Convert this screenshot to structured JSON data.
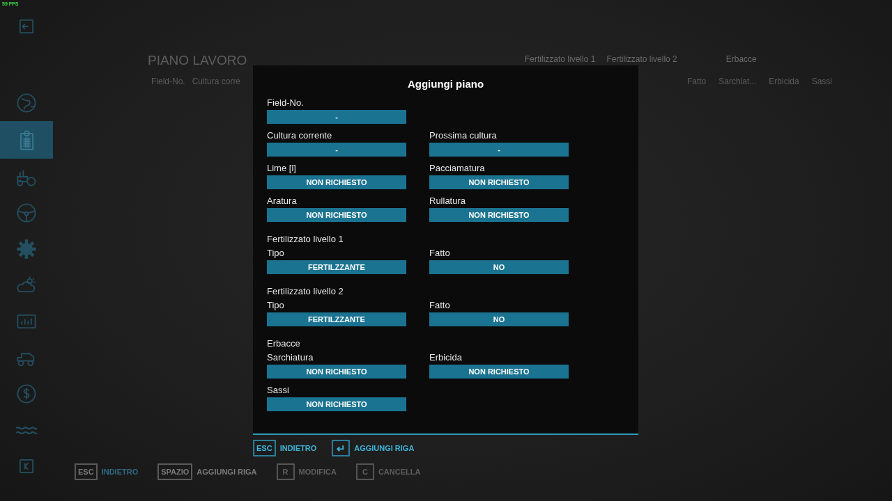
{
  "fps": "59 FPS",
  "sidebar": {
    "items": [
      {
        "kind": "back",
        "selected": false
      },
      {
        "kind": "globe",
        "selected": false
      },
      {
        "kind": "clipboard",
        "selected": true
      },
      {
        "kind": "tractor",
        "selected": false
      },
      {
        "kind": "wheel",
        "selected": false
      },
      {
        "kind": "gear",
        "selected": false
      },
      {
        "kind": "weather",
        "selected": false
      },
      {
        "kind": "chart",
        "selected": false
      },
      {
        "kind": "vehicle",
        "selected": false
      },
      {
        "kind": "coin",
        "selected": false
      },
      {
        "kind": "wave",
        "selected": false
      },
      {
        "kind": "key",
        "selected": false
      }
    ]
  },
  "page": {
    "title": "PIANO LAVORO",
    "group_headers": [
      "Fertilizzato livello 1",
      "Fertilizzato livello 2",
      "Erbacce"
    ],
    "columns_left": [
      "Field-No.",
      "Cultura corre"
    ],
    "columns_right": [
      "Fatto",
      "Sarchiat...",
      "Erbicida",
      "Sassi"
    ],
    "key_hints": [
      {
        "key": "ESC",
        "label": "INDIETRO",
        "disabled": false
      },
      {
        "key": "SPAZIO",
        "label": "AGGIUNGI RIGA",
        "disabled": false
      },
      {
        "key": "R",
        "label": "MODIFICA",
        "disabled": true
      },
      {
        "key": "C",
        "label": "CANCELLA",
        "disabled": true
      }
    ]
  },
  "dialog": {
    "title": "Aggiungi piano",
    "rows": [
      {
        "fields": [
          {
            "label": "Field-No.",
            "value": "-"
          }
        ]
      },
      {
        "fields": [
          {
            "label": "Cultura corrente",
            "value": "-"
          },
          {
            "label": "Prossima cultura",
            "value": "-"
          }
        ]
      },
      {
        "fields": [
          {
            "label": "Lime [l]",
            "value": "NON RICHIESTO"
          },
          {
            "label": "Pacciamatura",
            "value": "NON RICHIESTO"
          }
        ]
      },
      {
        "fields": [
          {
            "label": "Aratura",
            "value": "NON RICHIESTO"
          },
          {
            "label": "Rullatura",
            "value": "NON RICHIESTO"
          }
        ]
      },
      {
        "heading": "Fertilizzato livello 1",
        "fields": [
          {
            "label": "Tipo",
            "value": "FERTILZZANTE"
          },
          {
            "label": "Fatto",
            "value": "NO"
          }
        ]
      },
      {
        "heading": "Fertilizzato livello 2",
        "fields": [
          {
            "label": "Tipo",
            "value": "FERTILZZANTE"
          },
          {
            "label": "Fatto",
            "value": "NO"
          }
        ]
      },
      {
        "heading": "Erbacce",
        "fields": [
          {
            "label": "Sarchiatura",
            "value": "NON RICHIESTO"
          },
          {
            "label": "Erbicida",
            "value": "NON RICHIESTO"
          }
        ]
      },
      {
        "fields": [
          {
            "label": "Sassi",
            "value": "NON RICHIESTO"
          }
        ]
      }
    ],
    "key_hints": [
      {
        "key": "ESC",
        "label": "INDIETRO",
        "kind": "text"
      },
      {
        "key": "↵",
        "label": "AGGIUNGI RIGA",
        "kind": "symbol"
      }
    ]
  }
}
